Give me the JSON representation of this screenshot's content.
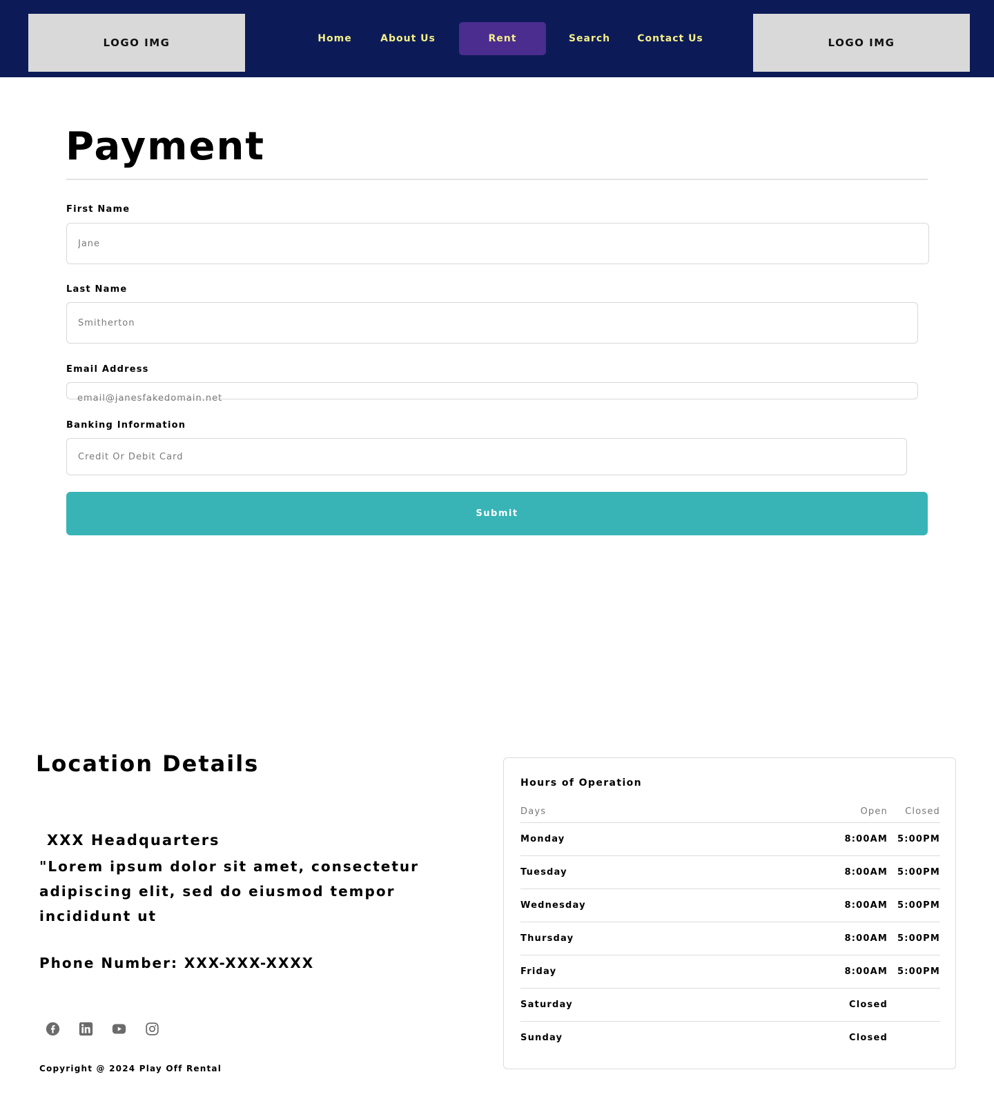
{
  "header": {
    "logo_left": "LOGO IMG",
    "logo_right": "LOGO IMG",
    "nav": [
      {
        "label": "Home"
      },
      {
        "label": "About Us"
      },
      {
        "label": "Rent"
      },
      {
        "label": "Search"
      },
      {
        "label": "Contact Us"
      }
    ],
    "active_nav": "Rent",
    "colors": {
      "background": "#0c1b57",
      "nav_text": "#f4ee8a",
      "active_bg": "#4a2d8f"
    }
  },
  "payment": {
    "title": "Payment",
    "first_name": {
      "label": "First Name",
      "placeholder": "Jane"
    },
    "last_name": {
      "label": "Last Name",
      "placeholder": "Smitherton"
    },
    "email": {
      "label": "Email Address",
      "placeholder": "email@janesfakedomain.net"
    },
    "banking": {
      "label": "Banking Information",
      "placeholder": "Credit Or Debit Card"
    },
    "submit_label": "Submit",
    "submit_color": "#38b4b6"
  },
  "location": {
    "title": "Location Details",
    "hq_name": "XXX Headquarters",
    "description": "\"Lorem ipsum dolor sit amet, consectetur adipiscing elit, sed do eiusmod tempor incididunt ut",
    "phone": "Phone Number: XXX-XXX-XXXX",
    "socials": [
      "facebook-icon",
      "linkedin-icon",
      "youtube-icon",
      "instagram-icon"
    ],
    "copyright": "Copyright @ 2024 Play Off Rental"
  },
  "hours": {
    "title": "Hours of Operation",
    "col_days": "Days",
    "col_open": "Open",
    "col_closed": "Closed",
    "rows": [
      {
        "day": "Monday",
        "open": "8:00AM",
        "close": "5:00PM"
      },
      {
        "day": "Tuesday",
        "open": "8:00AM",
        "close": "5:00PM"
      },
      {
        "day": "Wednesday",
        "open": "8:00AM",
        "close": "5:00PM"
      },
      {
        "day": "Thursday",
        "open": "8:00AM",
        "close": "5:00PM"
      },
      {
        "day": "Friday",
        "open": "8:00AM",
        "close": "5:00PM"
      },
      {
        "day": "Saturday",
        "closed": "Closed"
      },
      {
        "day": "Sunday",
        "closed": "Closed"
      }
    ]
  }
}
